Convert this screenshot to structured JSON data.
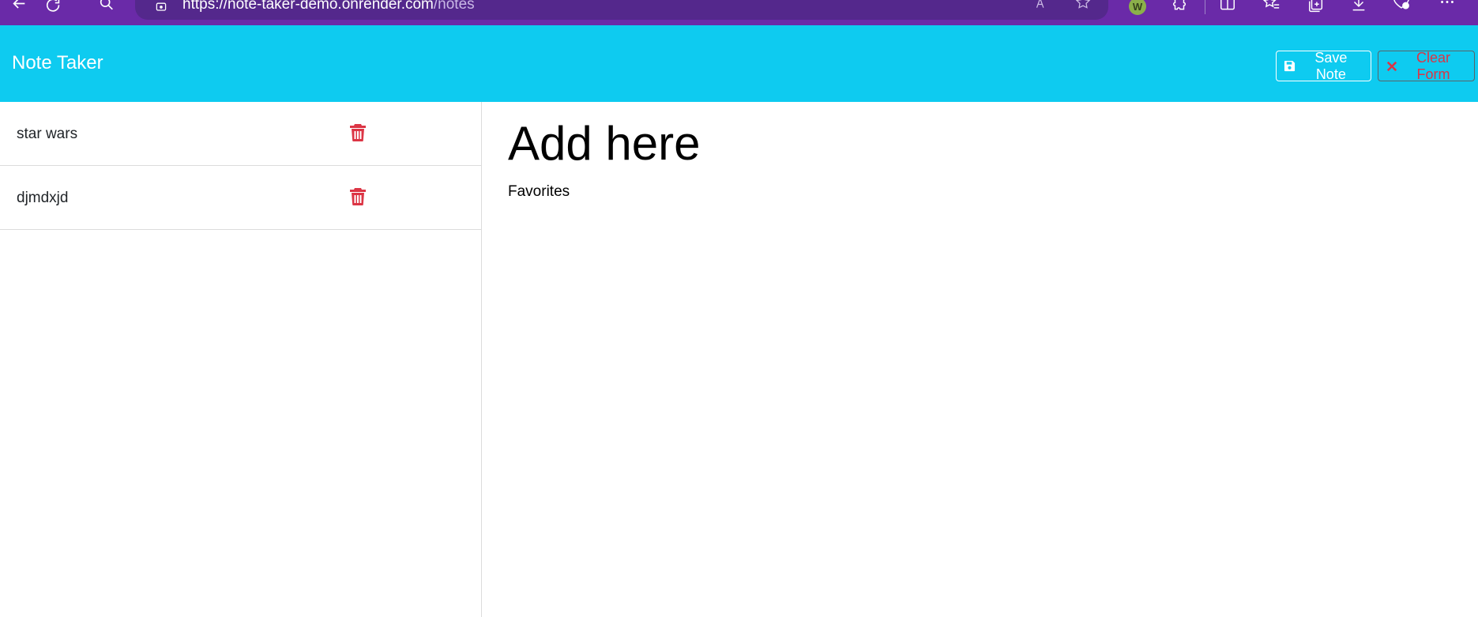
{
  "browser": {
    "url_host": "https://note-taker-demo.onrender.com",
    "url_path": "/notes",
    "avatar_letter": "W"
  },
  "header": {
    "title": "Note Taker",
    "save_label": "Save Note",
    "clear_label": "Clear Form"
  },
  "notes": [
    {
      "title": "star wars"
    },
    {
      "title": "djmdxjd"
    }
  ],
  "editor": {
    "title": "Add here",
    "text": "Favorites"
  },
  "colors": {
    "browser_chrome": "#6a2aa8",
    "header_bg": "#0ecbf0",
    "danger": "#dc3545"
  }
}
